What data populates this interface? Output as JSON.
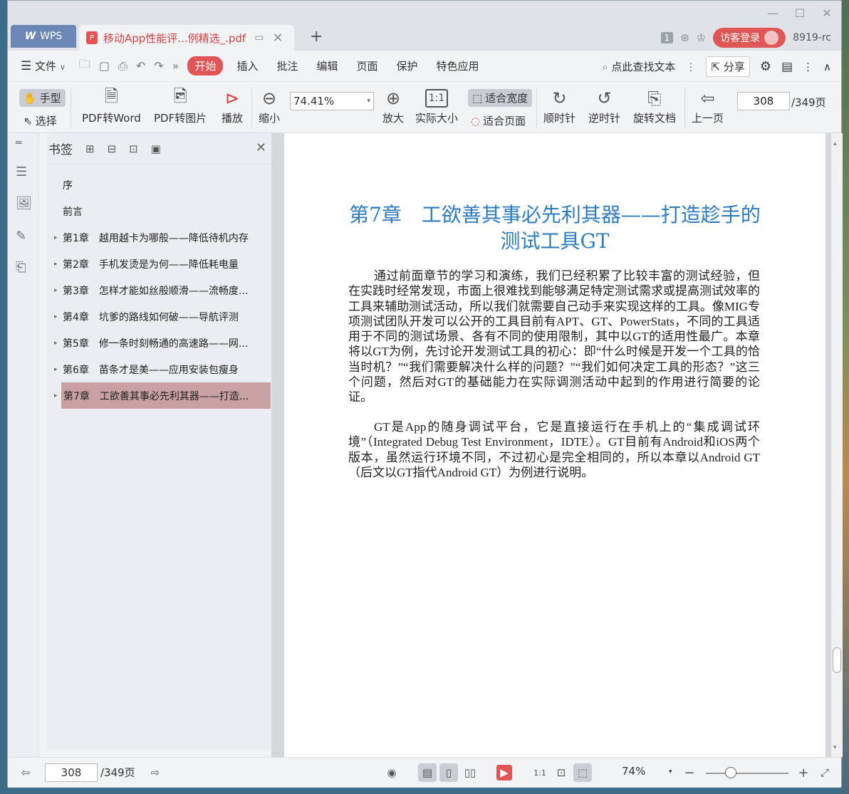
{
  "window": {
    "minimize": "—",
    "maximize": "☐",
    "close": "✕"
  },
  "tabs": {
    "home_label": "WPS",
    "doc_title": "移动App性能评...例精选_.pdf",
    "add": "+"
  },
  "title_right": {
    "page_badge": "1",
    "login": "访客登录",
    "user": "8919-rc"
  },
  "menu": {
    "file": "文件",
    "items": [
      "开始",
      "插入",
      "批注",
      "编辑",
      "页面",
      "保护",
      "特色应用"
    ],
    "search": "点此查找文本",
    "share": "分享"
  },
  "toolbar": {
    "hand": "手型",
    "select": "选择",
    "pdf_to_word": "PDF转Word",
    "pdf_to_image": "PDF转图片",
    "play": "播放",
    "zoom_out": "缩小",
    "zoom_value": "74.41%",
    "zoom_in": "放大",
    "actual_size": "实际大小",
    "fit_width": "适合宽度",
    "fit_page": "适合页面",
    "clockwise": "顺时针",
    "counterclockwise": "逆时针",
    "rotate_doc": "旋转文档",
    "prev_page": "上一页",
    "page_current": "308",
    "page_total": "/349页"
  },
  "bookmarks": {
    "title": "书签",
    "items": [
      {
        "chapter": "",
        "label": "序",
        "expandable": false
      },
      {
        "chapter": "",
        "label": "前言",
        "expandable": false
      },
      {
        "chapter": "第1章",
        "label": "越用越卡为哪般——降低待机内存",
        "expandable": true
      },
      {
        "chapter": "第2章",
        "label": "手机发烫是为何——降低耗电量",
        "expandable": true
      },
      {
        "chapter": "第3章",
        "label": "怎样才能如丝般顺滑——流畅度...",
        "expandable": true
      },
      {
        "chapter": "第4章",
        "label": "坑爹的路线如何破——导航评测",
        "expandable": true
      },
      {
        "chapter": "第5章",
        "label": "修一条时刻畅通的高速路——网...",
        "expandable": true
      },
      {
        "chapter": "第6章",
        "label": "苗条才是美——应用安装包瘦身",
        "expandable": true
      },
      {
        "chapter": "第7章",
        "label": "工欲善其事必先利其器——打造...",
        "expandable": true,
        "selected": true
      }
    ]
  },
  "document": {
    "chapter_title": "第7章　工欲善其事必先利其器——打造趁手的测试工具GT",
    "paragraph_1": "通过前面章节的学习和演练，我们已经积累了比较丰富的测试经验，但在实践时经常发现，市面上很难找到能够满足特定测试需求或提高测试效率的工具来辅助测试活动，所以我们就需要自己动手来实现这样的工具。像MIG专项测试团队开发可以公开的工具目前有APT、GT、PowerStats，不同的工具适用于不同的测试场景、各有不同的使用限制，其中以GT的适用性最广。本章将以GT为例，先讨论开发测试工具的初心：即“什么时候是开发一个工具的恰当时机？”“我们需要解决什么样的问题？”“我们如何决定工具的形态？”这三个问题，然后对GT的基础能力在实际调测活动中起到的作用进行简要的论证。",
    "paragraph_2": "GT是App的随身调试平台，它是直接运行在手机上的“集成调试环境”（Integrated Debug Test Environment，IDTE）。GT目前有Android和iOS两个版本，虽然运行环境不同，不过初心是完全相同的，所以本章以Android GT（后文以GT指代Android GT）为例进行说明。"
  },
  "status": {
    "page_current": "308",
    "page_total": "/349页",
    "zoom": "74%",
    "zoom_fraction": 0.3
  }
}
